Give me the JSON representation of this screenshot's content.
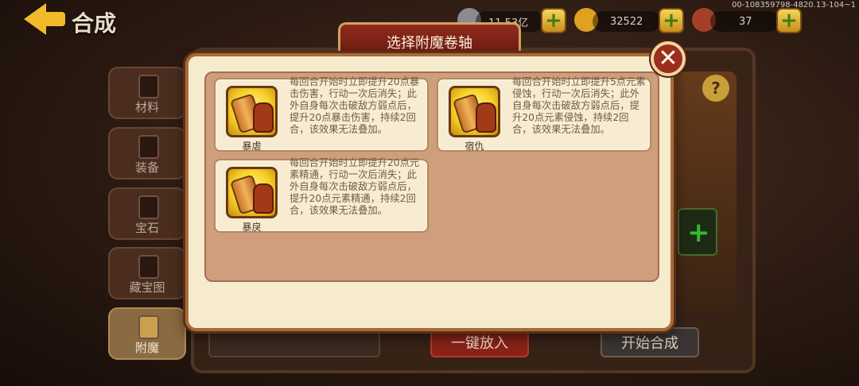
{
  "top_bar": {
    "title": "合成",
    "resources": [
      {
        "icon": "coin-icon",
        "value": "11.53亿"
      },
      {
        "icon": "gold-ingot-icon",
        "value": "32522"
      },
      {
        "icon": "meat-stamina-icon",
        "value": "37"
      }
    ],
    "debug_id": "00-108359798-4820.13-104~1"
  },
  "sidebar": {
    "items": [
      {
        "label": "材料",
        "active": false
      },
      {
        "label": "装备",
        "active": false
      },
      {
        "label": "宝石",
        "active": false
      },
      {
        "label": "藏宝图",
        "active": false
      },
      {
        "label": "附魔",
        "active": true
      }
    ]
  },
  "bottom": {
    "one_click_label": "一键放入",
    "start_label": "开始合成"
  },
  "modal": {
    "title": "选择附魔卷轴",
    "scrolls": [
      {
        "name": "暴虐",
        "description": "每回合开始时立即提升20点暴击伤害，行动一次后消失；此外自身每次击破敌方弱点后，提升20点暴击伤害，持续2回合，该效果无法叠加。"
      },
      {
        "name": "宿仇",
        "description": "每回合开始时立即提升5点元素侵蚀，行动一次后消失；此外自身每次击破敌方弱点后，提升20点元素侵蚀，持续2回合，该效果无法叠加。"
      },
      {
        "name": "暴戾",
        "description": "每回合开始时立即提升20点元素精通，行动一次后消失；此外自身每次击破敌方弱点后，提升20点元素精通，持续2回合，该效果无法叠加。"
      }
    ]
  },
  "colors": {
    "modal_bg": "#f6ebcc",
    "modal_inner": "#cf9e7d",
    "header_red": "#8e2a1c",
    "accent_gold": "#f2b92a"
  }
}
